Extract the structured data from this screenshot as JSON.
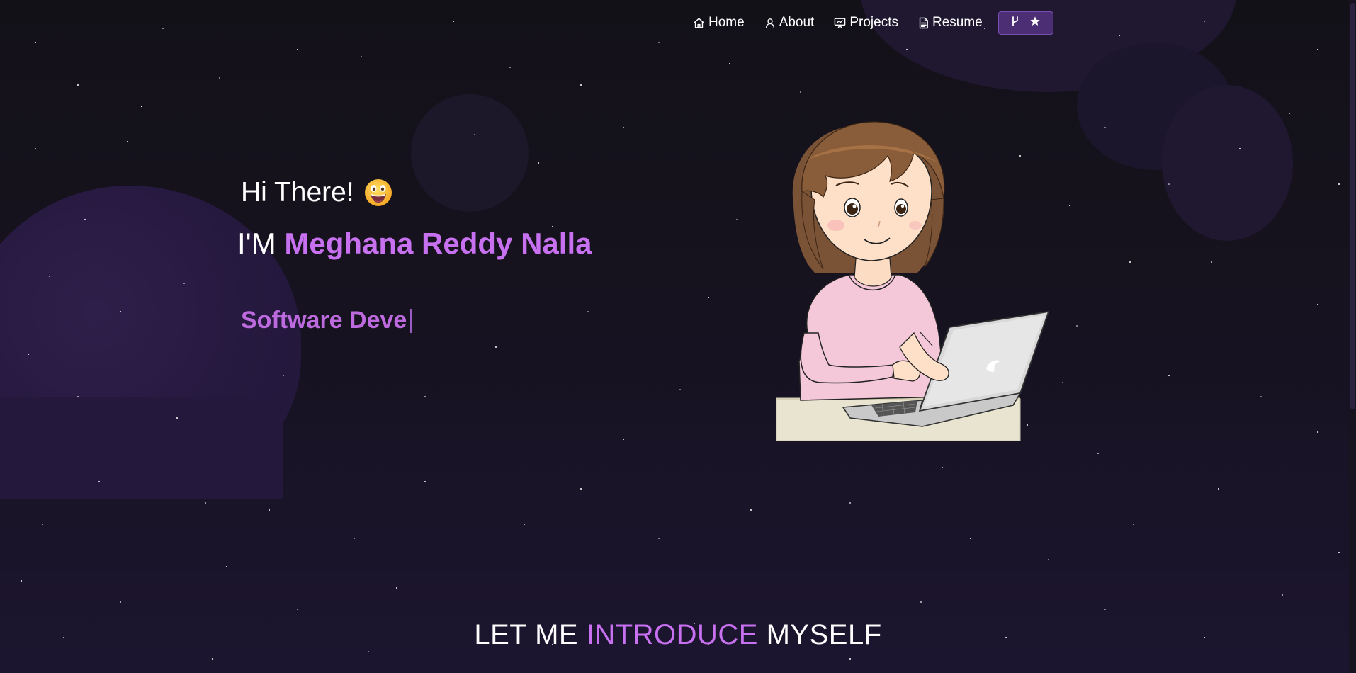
{
  "nav": {
    "items": [
      {
        "label": "Home",
        "icon": "home-icon"
      },
      {
        "label": "About",
        "icon": "user-icon"
      },
      {
        "label": "Projects",
        "icon": "projects-icon"
      },
      {
        "label": "Resume",
        "icon": "document-icon"
      }
    ],
    "github_button": {
      "icons": [
        "fork-icon",
        "star-icon"
      ]
    }
  },
  "hero": {
    "greeting": "Hi There!",
    "greeting_emoji": "grinning-face",
    "intro_prefix": "I'M",
    "name": "Meghana Reddy Nalla",
    "typewriter_text": "Software Deve"
  },
  "section": {
    "heading_part1": "LET ME",
    "heading_highlight": "INTRODUCE",
    "heading_part2": "MYSELF"
  },
  "colors": {
    "accent_purple": "#c770f0",
    "background": "#131118",
    "button_bg": "#4b2e73"
  }
}
